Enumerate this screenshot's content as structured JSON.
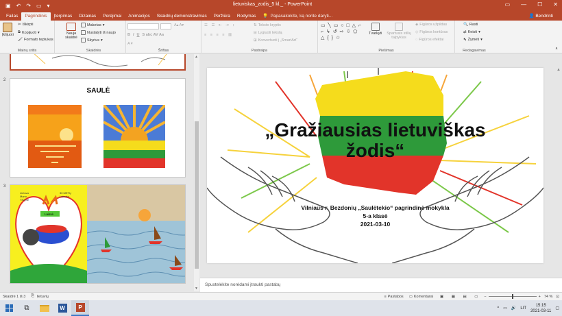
{
  "app": {
    "window_title": "lietuviskas_zodis_5 kl._ - PowerPoint",
    "share_label": "Bendrinti",
    "tell_me": "Papasakokite, ką norite daryti..."
  },
  "tabs": [
    "Failas",
    "Pagrindinis",
    "Įterpimas",
    "Dizainas",
    "Perėjimai",
    "Animacijos",
    "Skaidrių demonstravimas",
    "Peržiūra",
    "Rodymas"
  ],
  "active_tab": "Pagrindinis",
  "ribbon": {
    "clipboard": {
      "paste": "Įklijuoti",
      "cut": "Iškirpti",
      "copy": "Kopijuoti",
      "format_painter": "Formato teptukas",
      "group": "Mainų sritis"
    },
    "slides": {
      "new_slide": "Nauja skaidrė",
      "layout": "Maketas",
      "reset": "Nustatyti iš naujo",
      "section": "Skyrius",
      "group": "Skaidrės"
    },
    "font": {
      "group": "Šriftas"
    },
    "paragraph": {
      "text_direction": "Teksto kryptis",
      "align_text": "Lygiuoti tekstą",
      "smartart": "Konvertuoti į „SmartArt“",
      "group": "Pastraipa"
    },
    "drawing": {
      "arrange": "Tvarkyti",
      "quick_styles": "Spartusis stilių talpyklas",
      "shape_fill": "Figūros užpildas",
      "shape_outline": "Figūros kontūras",
      "shape_effects": "Figūros efektai",
      "group": "Piešimas"
    },
    "editing": {
      "find": "Rasti",
      "replace": "Keisti",
      "select": "Žymėti",
      "group": "Redagavimas"
    }
  },
  "thumbnails": [
    {
      "num": "2",
      "title": "SAULĖ"
    },
    {
      "num": "3",
      "labels": [
        "Lietuva",
        "Mano",
        "Tėvynė",
        "30 METŲ",
        "Laisvės",
        "Laisvė"
      ]
    }
  ],
  "slide": {
    "title_line1": "„Gražiausias lietuviškas",
    "title_line2": "žodis“",
    "school": "Vilniaus r. Bezdonių „Saulėtekio“ pagrindinė mokykla",
    "grade": "5-a klasė",
    "date": "2021-03-10"
  },
  "notes_placeholder": "Spustelėkite norėdami įtraukti pastabų",
  "status": {
    "slide_count": "Skaidrė 1 iš 3",
    "language": "lietuvių",
    "notes_btn": "Pastabos",
    "comments_btn": "Komentarai",
    "zoom": "74 %"
  },
  "taskbar": {
    "lang": "LIT",
    "time": "15:15",
    "date": "2021-03-11"
  },
  "colors": {
    "accent": "#b7472a",
    "flag_yellow": "#f5dc1c",
    "flag_green": "#2e9a3a",
    "flag_red": "#e2342a"
  }
}
